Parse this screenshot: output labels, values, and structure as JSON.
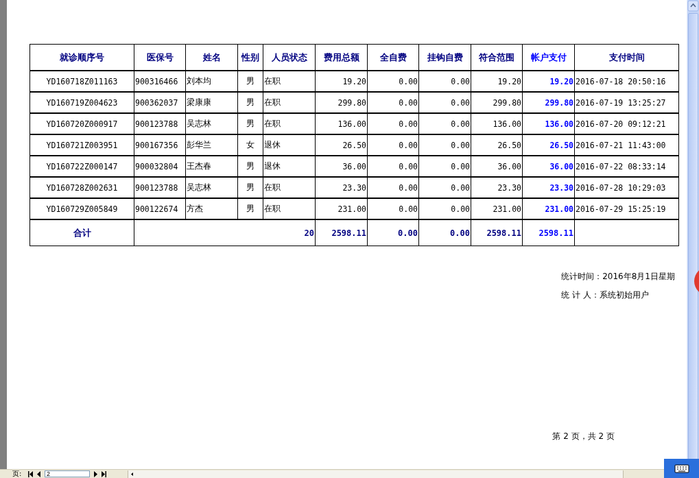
{
  "report": {
    "columns": [
      {
        "label": "就诊顺序号",
        "highlight": false
      },
      {
        "label": "医保号",
        "highlight": false
      },
      {
        "label": "姓名",
        "highlight": false
      },
      {
        "label": "性别",
        "highlight": false
      },
      {
        "label": "人员状态",
        "highlight": false
      },
      {
        "label": "费用总额",
        "highlight": false
      },
      {
        "label": "全自费",
        "highlight": false
      },
      {
        "label": "挂钩自费",
        "highlight": false
      },
      {
        "label": "符合范围",
        "highlight": false
      },
      {
        "label": "帐户支付",
        "highlight": true
      },
      {
        "label": "支付时间",
        "highlight": false
      }
    ],
    "rows": [
      [
        "YD160718Z011163",
        "900316466",
        "刘本均",
        "男",
        "在职",
        "19.20",
        "0.00",
        "0.00",
        "19.20",
        "19.20",
        "2016-07-18 20:50:16"
      ],
      [
        "YD160719Z004623",
        "900362037",
        "梁康康",
        "男",
        "在职",
        "299.80",
        "0.00",
        "0.00",
        "299.80",
        "299.80",
        "2016-07-19 13:25:27"
      ],
      [
        "YD160720Z000917",
        "900123788",
        "吴志林",
        "男",
        "在职",
        "136.00",
        "0.00",
        "0.00",
        "136.00",
        "136.00",
        "2016-07-20 09:12:21"
      ],
      [
        "YD160721Z003951",
        "900167356",
        "彭华兰",
        "女",
        "退休",
        "26.50",
        "0.00",
        "0.00",
        "26.50",
        "26.50",
        "2016-07-21 11:43:00"
      ],
      [
        "YD160722Z000147",
        "900032804",
        "王杰春",
        "男",
        "退休",
        "36.00",
        "0.00",
        "0.00",
        "36.00",
        "36.00",
        "2016-07-22 08:33:14"
      ],
      [
        "YD160728Z002631",
        "900123788",
        "吴志林",
        "男",
        "在职",
        "23.30",
        "0.00",
        "0.00",
        "23.30",
        "23.30",
        "2016-07-28 10:29:03"
      ],
      [
        "YD160729Z005849",
        "900122674",
        "方杰",
        "男",
        "在职",
        "231.00",
        "0.00",
        "0.00",
        "231.00",
        "231.00",
        "2016-07-29 15:25:19"
      ]
    ],
    "total": {
      "label": "合计",
      "count": "20",
      "values": [
        "2598.11",
        "0.00",
        "0.00",
        "2598.11",
        "2598.11"
      ]
    },
    "stats": [
      "统计时间：2016年8月1日星期",
      "统 计 人：系统初始用户"
    ],
    "page_number": "第 2 页，共 2 页"
  },
  "nav_bar": {
    "page_label": "页:",
    "page_input": "2"
  }
}
